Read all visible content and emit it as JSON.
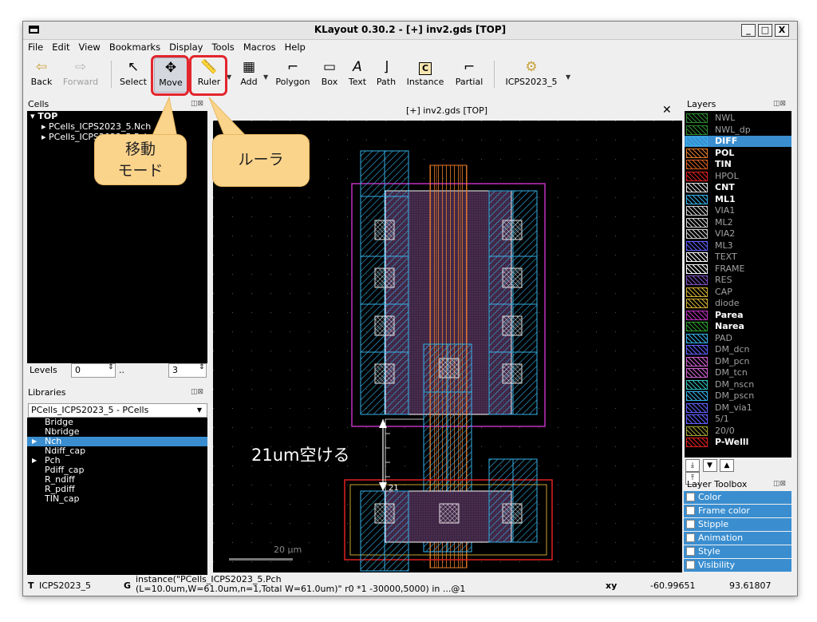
{
  "window": {
    "title": "KLayout 0.30.2 - [+] inv2.gds [TOP]",
    "buttons": {
      "minimize": "_",
      "maximize": "□",
      "close": "X"
    }
  },
  "menu": [
    "File",
    "Edit",
    "View",
    "Bookmarks",
    "Display",
    "Tools",
    "Macros",
    "Help"
  ],
  "toolbar": {
    "back": "Back",
    "forward": "Forward",
    "select": "Select",
    "move": "Move",
    "ruler": "Ruler",
    "add": "Add",
    "polygon": "Polygon",
    "box": "Box",
    "text": "Text",
    "path": "Path",
    "instance": "Instance",
    "partial": "Partial",
    "tech": "ICPS2023_5"
  },
  "cells_panel": {
    "title": "Cells",
    "items": [
      "TOP",
      "PCells_ICPS2023_5.Nch",
      "PCells_ICPS2023_5.Pch"
    ]
  },
  "levels": {
    "label": "Levels",
    "from": "0",
    "sep": "..",
    "to": "3"
  },
  "libraries_panel": {
    "title": "Libraries",
    "selected": "PCells_ICPS2023_5 - PCells",
    "items": [
      "Bridge",
      "Nbridge",
      "Nch",
      "Ndiff_cap",
      "Pch",
      "Pdiff_cap",
      "R_ndiff",
      "R_pdiff",
      "TIN_cap"
    ]
  },
  "canvas": {
    "title": "[+] inv2.gds [TOP]",
    "close": "✕",
    "ruler_value": "21",
    "scale_label": "20 µm",
    "annotation": "21um空ける"
  },
  "layers_panel": {
    "title": "Layers",
    "items": [
      {
        "name": "NWL",
        "style": "dim",
        "color": "#2d8a2d"
      },
      {
        "name": "NWL_dp",
        "style": "dim",
        "color": "#2d8a2d"
      },
      {
        "name": "DIFF",
        "style": "sel",
        "color": "#35b0e8"
      },
      {
        "name": "POL",
        "style": "bold",
        "color": "#e87a28"
      },
      {
        "name": "TIN",
        "style": "bold",
        "color": "#d86020"
      },
      {
        "name": "HPOL",
        "style": "dim",
        "color": "#e02020"
      },
      {
        "name": "CNT",
        "style": "bold",
        "color": "#e0e0e0"
      },
      {
        "name": "ML1",
        "style": "bold",
        "color": "#35b0e8"
      },
      {
        "name": "VIA1",
        "style": "dim",
        "color": "#d0d0d0"
      },
      {
        "name": "ML2",
        "style": "dim",
        "color": "#d0d0d0"
      },
      {
        "name": "VIA2",
        "style": "dim",
        "color": "#d0d0d0"
      },
      {
        "name": "ML3",
        "style": "dim",
        "color": "#6060ff"
      },
      {
        "name": "TEXT",
        "style": "dim",
        "color": "#ffffff"
      },
      {
        "name": "FRAME",
        "style": "dim",
        "color": "#ffffff"
      },
      {
        "name": "RES",
        "style": "dim",
        "color": "#8050c0"
      },
      {
        "name": "CAP",
        "style": "dim",
        "color": "#d0b030"
      },
      {
        "name": "diode",
        "style": "dim",
        "color": "#d0b030"
      },
      {
        "name": "Parea",
        "style": "bold",
        "color": "#c030c0"
      },
      {
        "name": "Narea",
        "style": "bold",
        "color": "#30a030"
      },
      {
        "name": "PAD",
        "style": "dim",
        "color": "#35b0e8"
      },
      {
        "name": "DM_dcn",
        "style": "dim",
        "color": "#6060ff"
      },
      {
        "name": "DM_pcn",
        "style": "dim",
        "color": "#d060d0"
      },
      {
        "name": "DM_tcn",
        "style": "dim",
        "color": "#d060d0"
      },
      {
        "name": "DM_nscn",
        "style": "dim",
        "color": "#30c0c0"
      },
      {
        "name": "DM_pscn",
        "style": "dim",
        "color": "#35b0e8"
      },
      {
        "name": "DM_via1",
        "style": "dim",
        "color": "#6060ff"
      },
      {
        "name": "5/1",
        "style": "dim",
        "color": "#6060ff"
      },
      {
        "name": "20/0",
        "style": "dim",
        "color": "#a0a030"
      },
      {
        "name": "P-Welll",
        "style": "bold",
        "color": "#e02020"
      }
    ]
  },
  "layer_toolbox": {
    "title": "Layer Toolbox",
    "items": [
      "Color",
      "Frame color",
      "Stipple",
      "Animation",
      "Style",
      "Visibility"
    ]
  },
  "status": {
    "tech_prefix": "T",
    "tech": "ICPS2023_5",
    "g_prefix": "G",
    "instance_line1": "instance(\"PCells_ICPS2023_5.Pch",
    "instance_line2": "(L=10.0um,W=61.0um,n=1,Total W=61.0um)\" r0 *1 -30000,5000) in ...@1",
    "xy_label": "xy",
    "x": "-60.99651",
    "y": "93.61807"
  },
  "callouts": {
    "move": "移動\nモード",
    "ruler": "ルーラ"
  },
  "colors": {
    "accent": "#3a8ed0",
    "highlight": "#e3252d",
    "callout": "#fbd48c",
    "diff": "#35b0e8",
    "poly": "#e87a28"
  }
}
